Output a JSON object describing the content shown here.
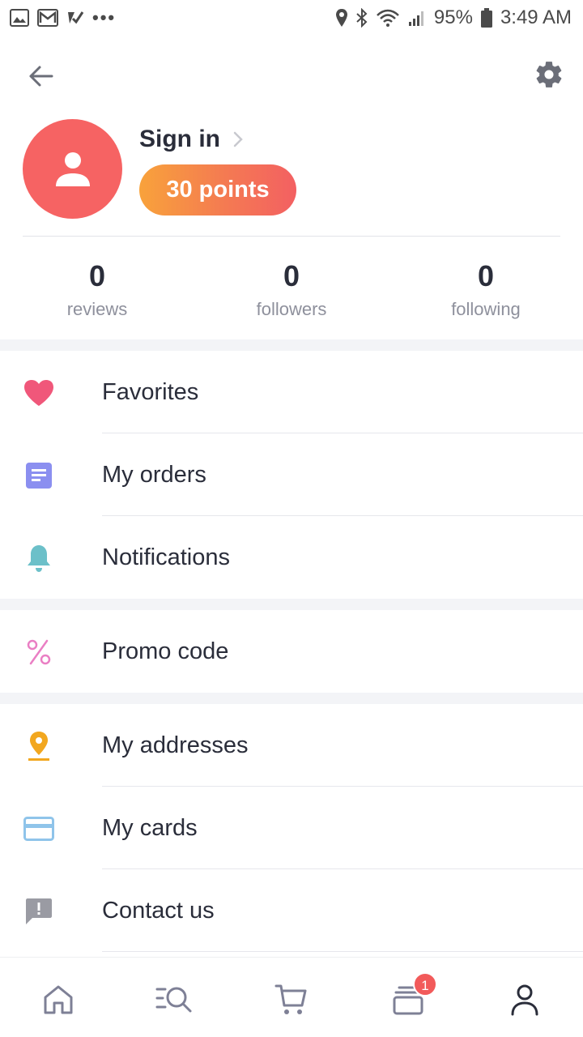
{
  "status_bar": {
    "battery": "95%",
    "time": "3:49 AM",
    "more": "•••",
    "icons": [
      "image-icon",
      "gmail-icon",
      "check-icon",
      "location-icon",
      "bluetooth-icon",
      "wifi-icon",
      "signal-icon",
      "battery-icon"
    ]
  },
  "header": {
    "back_icon": "arrow-left-icon",
    "settings_icon": "gear-icon"
  },
  "profile": {
    "sign_in": "Sign in",
    "points": "30 points",
    "avatar_color": "#f66363"
  },
  "stats": [
    {
      "value": "0",
      "label": "reviews"
    },
    {
      "value": "0",
      "label": "followers"
    },
    {
      "value": "0",
      "label": "following"
    }
  ],
  "menu": {
    "favorites": "Favorites",
    "orders": "My orders",
    "notifications": "Notifications",
    "promo": "Promo code",
    "addresses": "My addresses",
    "cards": "My cards",
    "contact": "Contact us"
  },
  "bottom_nav": {
    "items": [
      "home-icon",
      "search-icon",
      "cart-icon",
      "orders-icon",
      "profile-icon"
    ],
    "badge": "1"
  },
  "colors": {
    "heart": "#f0577a",
    "orders": "#8b8ff0",
    "bell": "#6cc0c9",
    "promo": "#ea7fc4",
    "address": "#f2a71f",
    "card": "#8fc4ea",
    "contact": "#9a9ba3",
    "badge": "#f25a5a"
  }
}
